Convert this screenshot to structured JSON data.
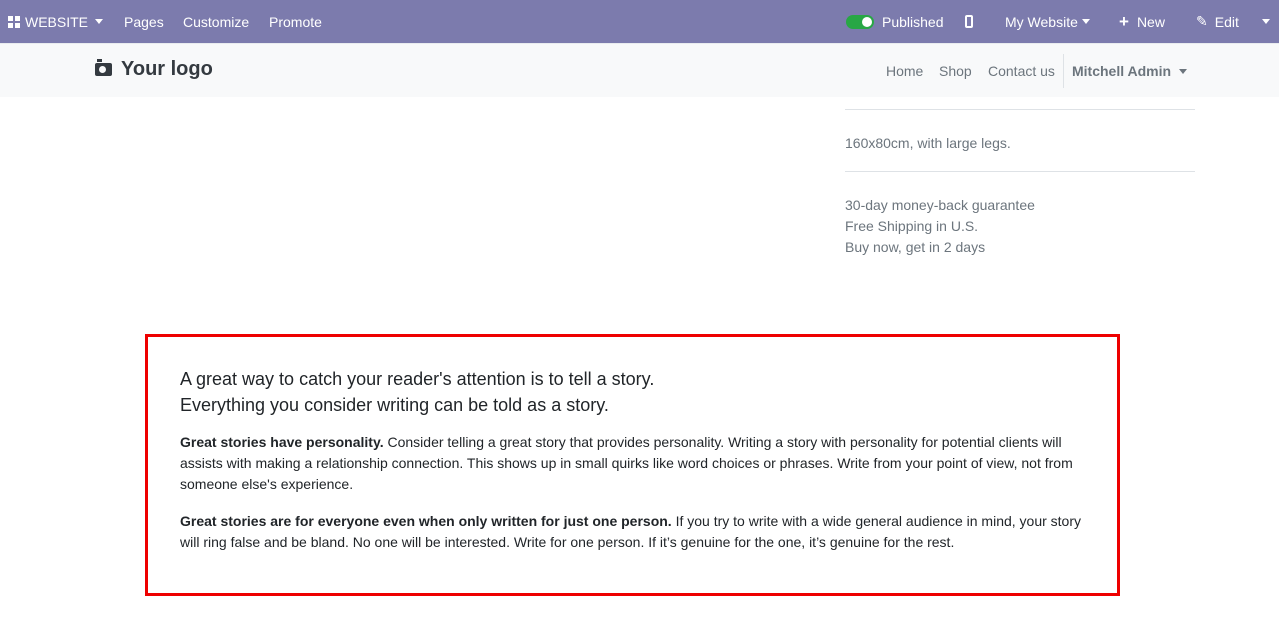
{
  "adminbar": {
    "website_label": "WEBSITE",
    "menu": [
      "Pages",
      "Customize",
      "Promote"
    ],
    "published_label": "Published",
    "site_selector": "My Website",
    "new_label": "New",
    "edit_label": "Edit",
    "colors": {
      "background": "#7c7bad",
      "toggle_on": "#28a745"
    }
  },
  "header": {
    "logo_text": "Your logo",
    "nav": [
      "Home",
      "Shop",
      "Contact us"
    ],
    "user": "Mitchell Admin"
  },
  "product": {
    "dimensions": "160x80cm, with large legs.",
    "perks": [
      "30-day money-back guarantee",
      "Free Shipping in U.S.",
      "Buy now, get in 2 days"
    ]
  },
  "story": {
    "lead_line_1": "A great way to catch your reader's attention is to tell a story.",
    "lead_line_2": "Everything you consider writing can be told as a story.",
    "p1_bold": "Great stories have personality.",
    "p1_text": " Consider telling a great story that provides personality. Writing a story with personality for potential clients will assists with making a relationship connection. This shows up in small quirks like word choices or phrases. Write from your point of view, not from someone else's experience.",
    "p2_bold": "Great stories are for everyone even when only written for just one person.",
    "p2_text": " If you try to write with a wide general audience in mind, your story will ring false and be bland. No one will be interested. Write for one person. If it’s genuine for the one, it’s genuine for the rest.",
    "highlight_color": "#ee0000"
  }
}
